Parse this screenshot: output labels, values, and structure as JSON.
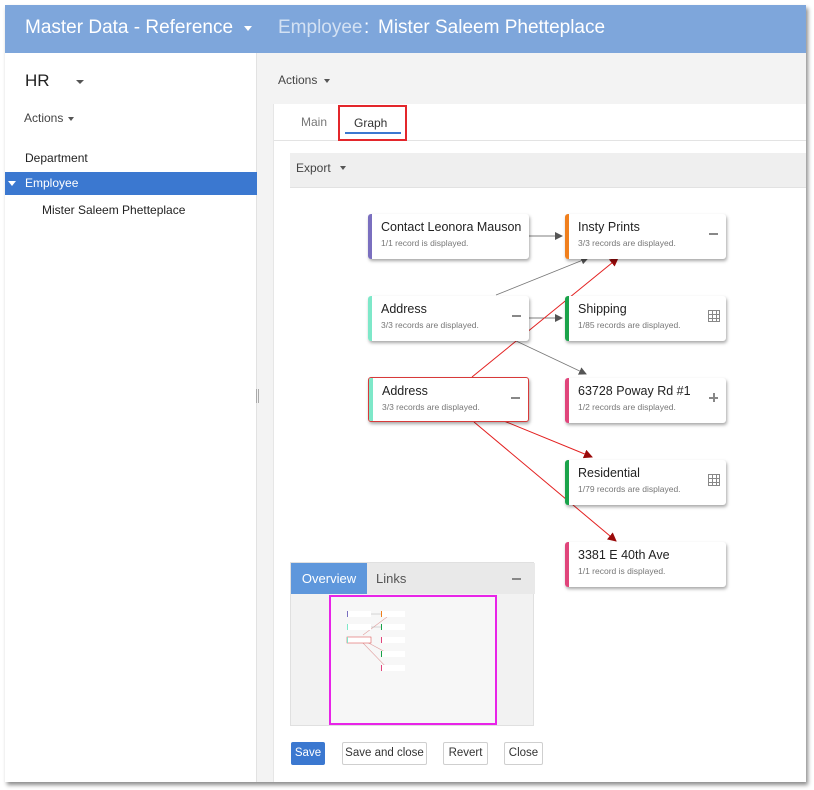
{
  "header": {
    "app_title": "Master Data - Reference",
    "entity": "Employee",
    "separator": ":",
    "record": "Mister Saleem Phetteplace"
  },
  "sidebar": {
    "title": "HR",
    "actions_label": "Actions",
    "items": [
      {
        "label": "Department"
      },
      {
        "label": "Employee"
      },
      {
        "label": "Mister Saleem Phetteplace"
      }
    ]
  },
  "main": {
    "actions_label": "Actions",
    "tabs": [
      {
        "label": "Main"
      },
      {
        "label": "Graph"
      }
    ],
    "export_label": "Export"
  },
  "graph": {
    "nodes": [
      {
        "title": "Contact Leonora Mauson",
        "subtitle": "1/1 record is displayed.",
        "color": "#7a6fbf",
        "icon": ""
      },
      {
        "title": "Address",
        "subtitle": "3/3 records are displayed.",
        "color": "#7ee8c9",
        "icon": "minus-icon"
      },
      {
        "title": "Address",
        "subtitle": "3/3 records are displayed.",
        "color": "#7ee8c9",
        "icon": "minus-icon"
      },
      {
        "title": "Insty Prints",
        "subtitle": "3/3 records are displayed.",
        "color": "#f07f1d",
        "icon": "minus-icon"
      },
      {
        "title": "Shipping",
        "subtitle": "1/85 records are displayed.",
        "color": "#1aa34a",
        "icon": "table-icon"
      },
      {
        "title": "63728 Poway Rd #1",
        "subtitle": "1/2 records are displayed.",
        "color": "#e0457b",
        "icon": "plus-icon"
      },
      {
        "title": "Residential",
        "subtitle": "1/79 records are displayed.",
        "color": "#1aa34a",
        "icon": "table-icon"
      },
      {
        "title": "3381 E 40th Ave",
        "subtitle": "1/1 record is displayed.",
        "color": "#e0457b",
        "icon": ""
      }
    ]
  },
  "overview": {
    "tabs": [
      {
        "label": "Overview"
      },
      {
        "label": "Links"
      }
    ]
  },
  "buttons": {
    "save": "Save",
    "save_close": "Save and close",
    "revert": "Revert",
    "close": "Close"
  },
  "colors": {
    "header_bg": "#7ea6db",
    "accent": "#3b78d0",
    "highlight": "#e3262b",
    "edge_red": "#e32020",
    "edge_gray": "#666666",
    "viewport": "#e824e8"
  }
}
